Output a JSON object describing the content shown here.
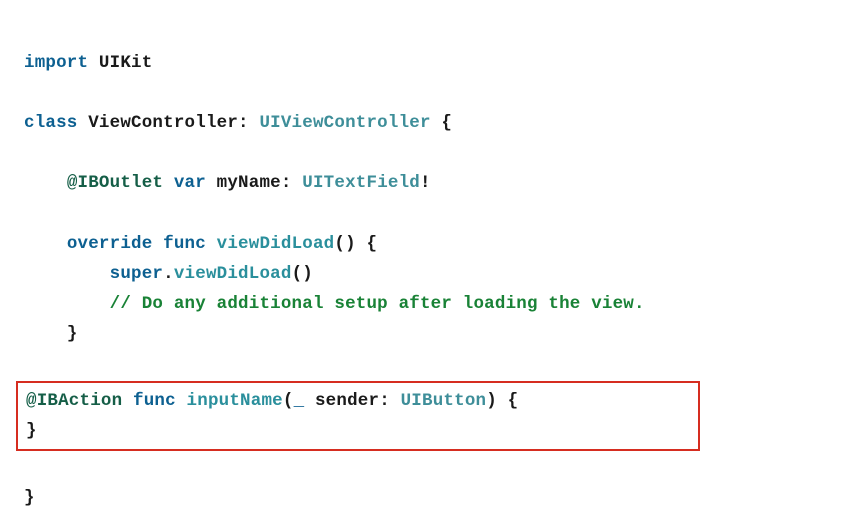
{
  "code": {
    "line1": {
      "kw_import": "import",
      "module": "UIKit"
    },
    "line3": {
      "kw_class": "class",
      "classname": "ViewController",
      "colon": ": ",
      "supertype": "UIViewController",
      "brace": " {"
    },
    "line5": {
      "annotation": "@IBOutlet",
      "kw_var": "var",
      "varname": "myName",
      "colon": ": ",
      "type": "UITextField",
      "bang": "!"
    },
    "line7": {
      "kw_override": "override",
      "kw_func": "func",
      "funcname": "viewDidLoad",
      "parens": "()",
      "brace": " {"
    },
    "line8": {
      "super": "super",
      "dot": ".",
      "call": "viewDidLoad",
      "parens": "()"
    },
    "line9": {
      "comment": "// Do any additional setup after loading the view."
    },
    "line10": {
      "brace": "}"
    },
    "line12": {
      "annotation": "@IBAction",
      "kw_func": "func",
      "funcname": "inputName",
      "paren_open": "(",
      "underscore": "_ ",
      "param": "sender",
      "colon": ": ",
      "type": "UIButton",
      "paren_close": ")",
      "brace": " {"
    },
    "line13": {
      "brace": "}"
    },
    "line15": {
      "brace": "}"
    }
  },
  "indent1": "    ",
  "indent2": "        "
}
